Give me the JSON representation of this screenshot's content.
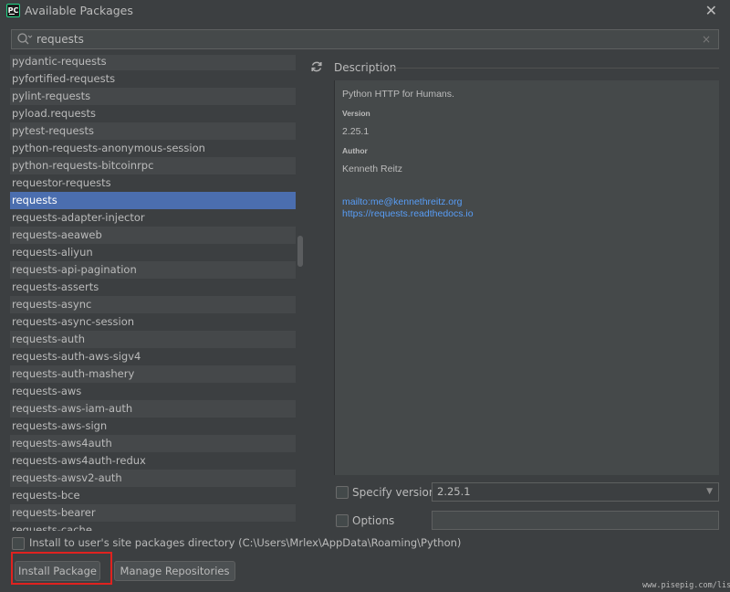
{
  "window": {
    "title": "Available Packages",
    "app_icon_text": "PC"
  },
  "search": {
    "value": "requests",
    "clear_glyph": "×"
  },
  "packages": [
    "pydantic-requests",
    "pyfortified-requests",
    "pylint-requests",
    "pyload.requests",
    "pytest-requests",
    "python-requests-anonymous-session",
    "python-requests-bitcoinrpc",
    "requestor-requests",
    "requests",
    "requests-adapter-injector",
    "requests-aeaweb",
    "requests-aliyun",
    "requests-api-pagination",
    "requests-asserts",
    "requests-async",
    "requests-async-session",
    "requests-auth",
    "requests-auth-aws-sigv4",
    "requests-auth-mashery",
    "requests-aws",
    "requests-aws-iam-auth",
    "requests-aws-sign",
    "requests-aws4auth",
    "requests-aws4auth-redux",
    "requests-awsv2-auth",
    "requests-bce",
    "requests-bearer",
    "requests-cache"
  ],
  "selected_package": "requests",
  "description": {
    "header": "Description",
    "summary": "Python HTTP for Humans.",
    "version_label": "Version",
    "version_value": "2.25.1",
    "author_label": "Author",
    "author_value": "Kenneth Reitz",
    "email_link": "mailto:me@kennethreitz.org",
    "docs_link": "https://requests.readthedocs.io"
  },
  "options": {
    "specify_version_label": "Specify version",
    "specify_version_value": "2.25.1",
    "options_label": "Options",
    "options_value": "",
    "install_user_label": "Install to user's site packages directory (C:\\Users\\Mrlex\\AppData\\Roaming\\Python)"
  },
  "buttons": {
    "install": "Install Package",
    "manage": "Manage Repositories"
  },
  "watermark": "www.pisepig.com/lisa",
  "colors": {
    "background": "#3c3f41",
    "selection": "#4b6eaf",
    "link": "#589df6",
    "highlight": "#e0221f"
  }
}
